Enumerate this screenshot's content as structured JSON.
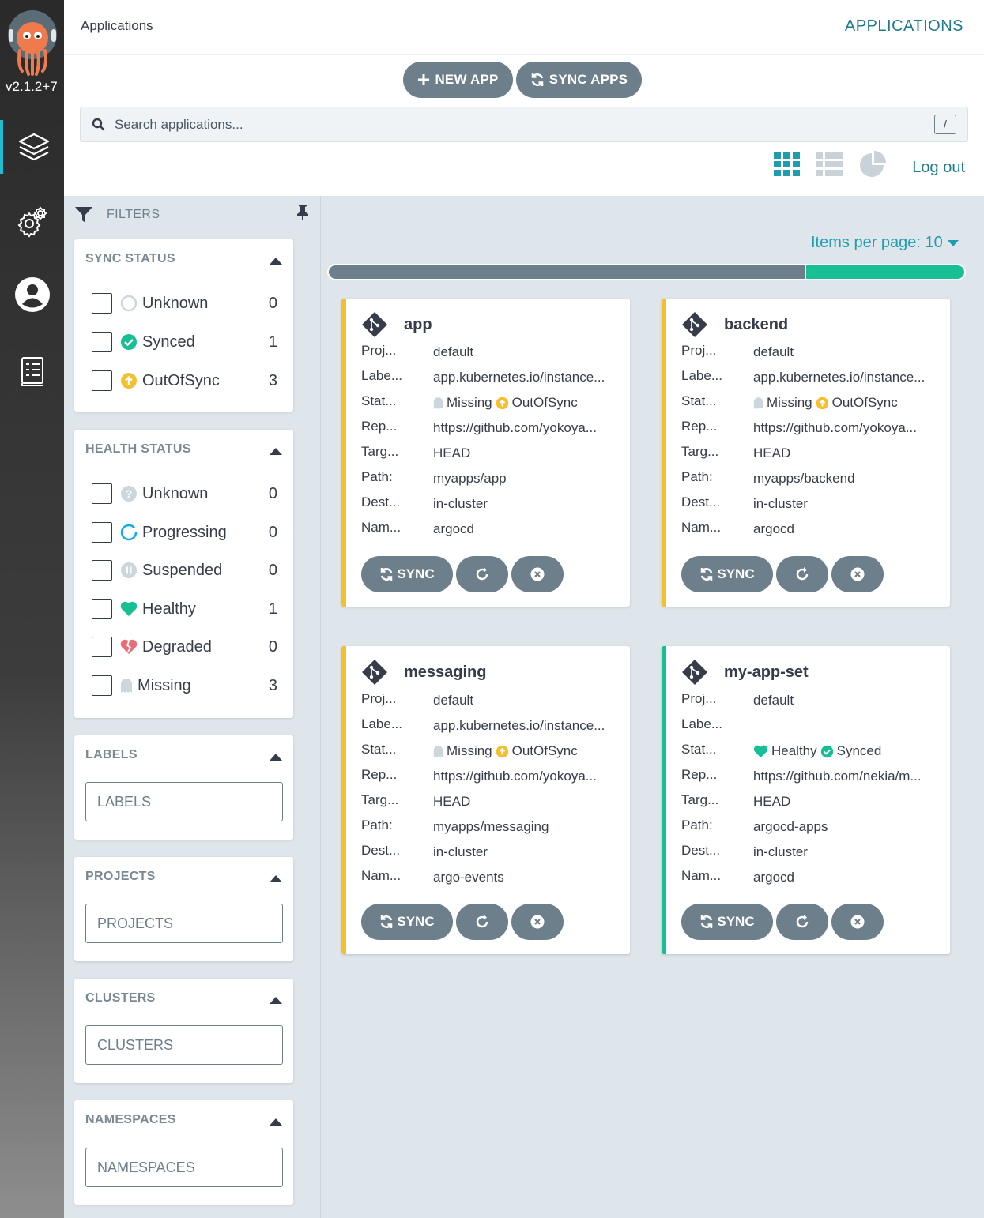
{
  "nav": {
    "version": "v2.1.2+7",
    "items": [
      {
        "icon": "layers-icon"
      },
      {
        "icon": "gear-icon"
      },
      {
        "icon": "user-icon"
      },
      {
        "icon": "docs-icon"
      }
    ]
  },
  "header": {
    "breadcrumb": "Applications",
    "title": "APPLICATIONS"
  },
  "toolbar": {
    "new_app_label": "NEW APP",
    "sync_apps_label": "SYNC APPS",
    "search_placeholder": "Search applications...",
    "search_shortcut": "/",
    "logout_label": "Log out"
  },
  "filters": {
    "title": "FILTERS",
    "sync_status": {
      "title": "SYNC STATUS",
      "items": [
        {
          "label": "Unknown",
          "count": "0",
          "icon": "unknown-circle-icon"
        },
        {
          "label": "Synced",
          "count": "1",
          "icon": "check-circle-icon"
        },
        {
          "label": "OutOfSync",
          "count": "3",
          "icon": "arrow-up-circle-icon"
        }
      ]
    },
    "health_status": {
      "title": "HEALTH STATUS",
      "items": [
        {
          "label": "Unknown",
          "count": "0",
          "icon": "question-circle-icon"
        },
        {
          "label": "Progressing",
          "count": "0",
          "icon": "progress-circle-icon"
        },
        {
          "label": "Suspended",
          "count": "0",
          "icon": "pause-circle-icon"
        },
        {
          "label": "Healthy",
          "count": "1",
          "icon": "heart-icon"
        },
        {
          "label": "Degraded",
          "count": "0",
          "icon": "broken-heart-icon"
        },
        {
          "label": "Missing",
          "count": "3",
          "icon": "ghost-icon"
        }
      ]
    },
    "labels": {
      "title": "LABELS",
      "placeholder": "LABELS"
    },
    "projects": {
      "title": "PROJECTS",
      "placeholder": "PROJECTS"
    },
    "clusters": {
      "title": "CLUSTERS",
      "placeholder": "CLUSTERS"
    },
    "namespaces": {
      "title": "NAMESPACES",
      "placeholder": "NAMESPACES"
    }
  },
  "main": {
    "items_per_page": "Items per page: 10",
    "status_bar": {
      "outofsync_fraction": 0.75,
      "synced_fraction": 0.25
    },
    "field_keys": {
      "project": "Proj...",
      "labels": "Labe...",
      "status": "Stat...",
      "repo": "Rep...",
      "target": "Targ...",
      "path": "Path:",
      "dest": "Dest...",
      "namespace": "Nam..."
    },
    "sync_label": "SYNC",
    "apps": [
      {
        "name": "app",
        "accent": "#f4c030",
        "project": "default",
        "labels": "app.kubernetes.io/instance...",
        "health": "Missing",
        "sync": "OutOfSync",
        "repo": "https://github.com/yokoya...",
        "target": "HEAD",
        "path": "myapps/app",
        "dest": "in-cluster",
        "namespace": "argocd"
      },
      {
        "name": "backend",
        "accent": "#f4c030",
        "project": "default",
        "labels": "app.kubernetes.io/instance...",
        "health": "Missing",
        "sync": "OutOfSync",
        "repo": "https://github.com/yokoya...",
        "target": "HEAD",
        "path": "myapps/backend",
        "dest": "in-cluster",
        "namespace": "argocd"
      },
      {
        "name": "messaging",
        "accent": "#f4c030",
        "project": "default",
        "labels": "app.kubernetes.io/instance...",
        "health": "Missing",
        "sync": "OutOfSync",
        "repo": "https://github.com/yokoya...",
        "target": "HEAD",
        "path": "myapps/messaging",
        "dest": "in-cluster",
        "namespace": "argo-events"
      },
      {
        "name": "my-app-set",
        "accent": "#18be94",
        "project": "default",
        "labels": "",
        "health": "Healthy",
        "sync": "Synced",
        "repo": "https://github.com/nekia/m...",
        "target": "HEAD",
        "path": "argocd-apps",
        "dest": "in-cluster",
        "namespace": "argocd"
      }
    ]
  },
  "colors": {
    "accent_teal": "#1e9db1",
    "outofsync": "#f4c030",
    "synced": "#18be94",
    "button": "#6d7f8b"
  }
}
